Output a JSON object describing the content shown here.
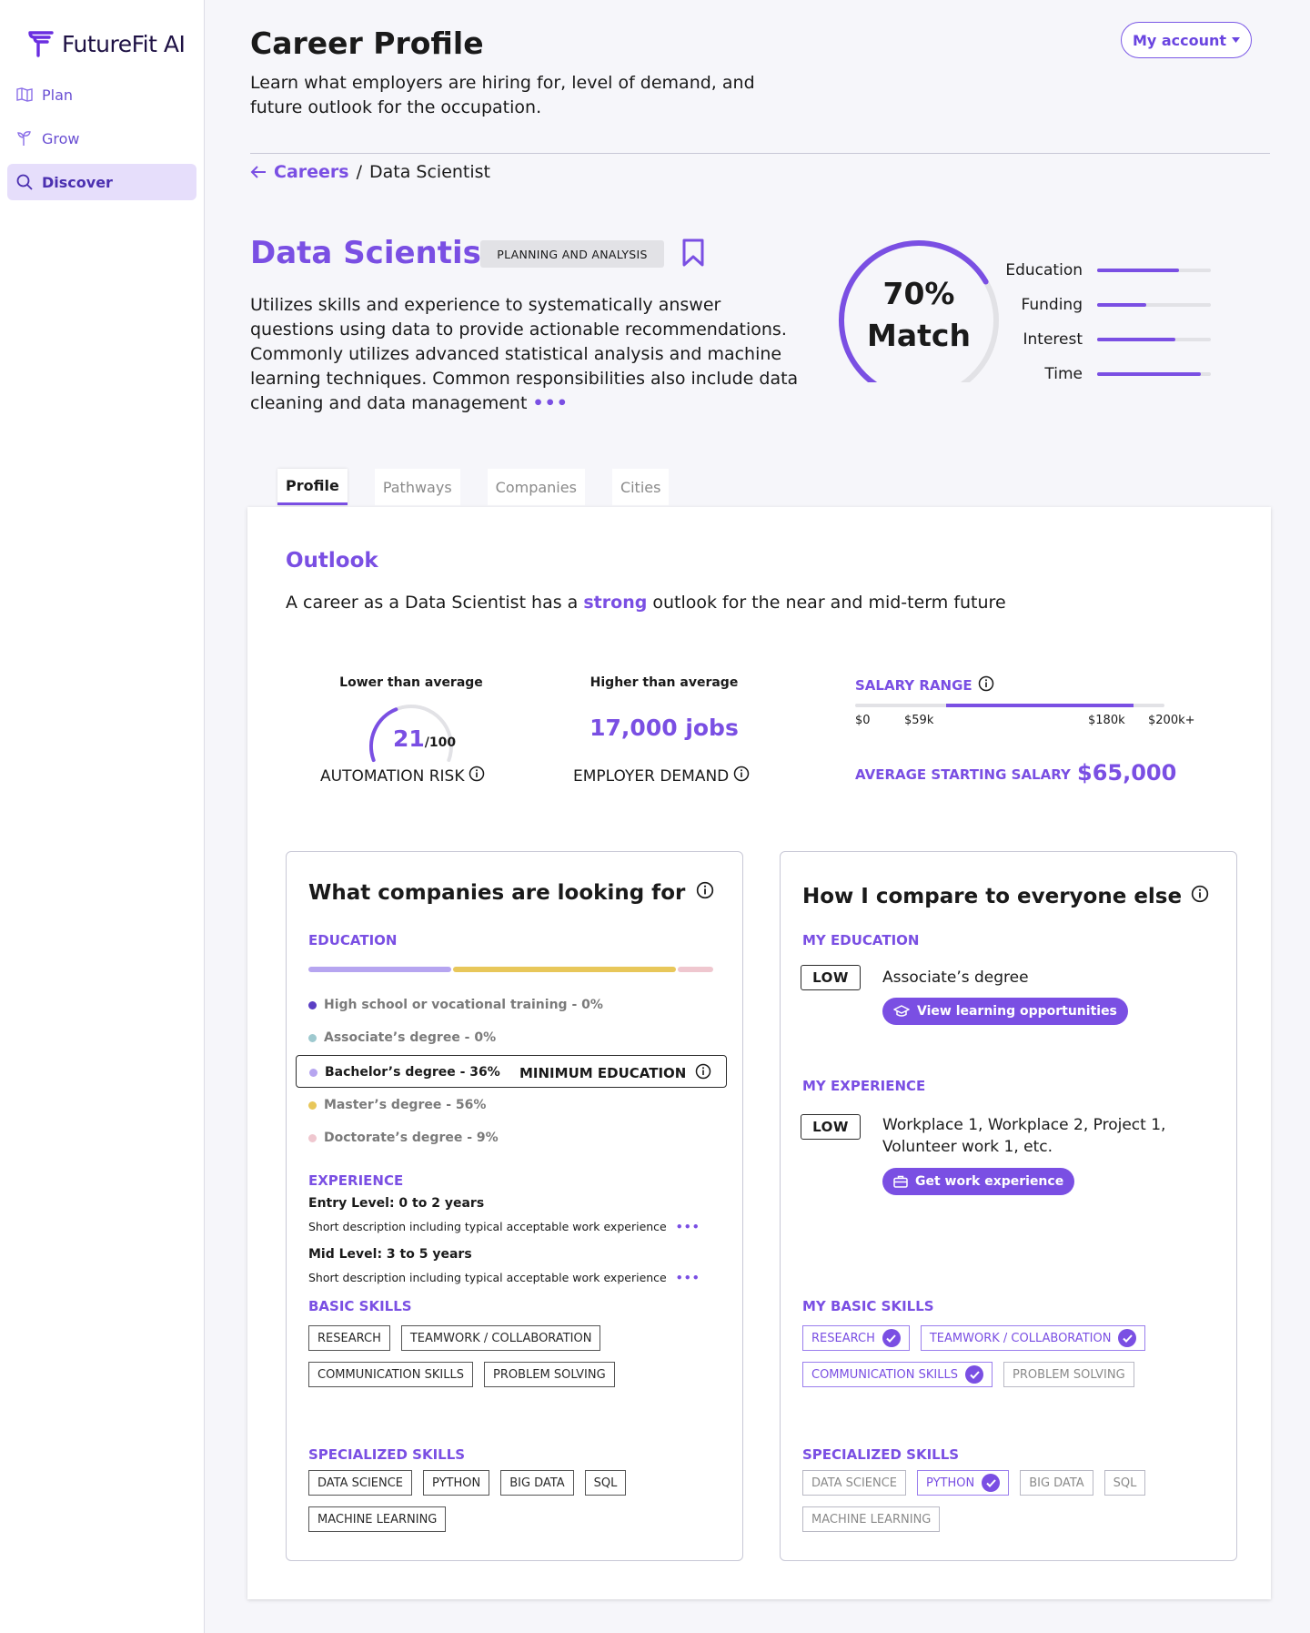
{
  "app": {
    "name": "FutureFit AI"
  },
  "nav": [
    {
      "label": "Plan",
      "icon": "map-icon"
    },
    {
      "label": "Grow",
      "icon": "sprout-icon"
    },
    {
      "label": "Discover",
      "icon": "search-icon",
      "active": true
    }
  ],
  "header": {
    "title": "Career Profile",
    "subtitle": "Learn what employers are hiring for, level of demand, and future outlook for the occupation.",
    "account_label": "My account"
  },
  "breadcrumb": {
    "parent": "Careers",
    "separator": "/",
    "current": "Data Scientist"
  },
  "career": {
    "title": "Data Scientist",
    "category": "PLANNING AND ANALYSIS",
    "description": "Utilizes skills and experience to systematically answer questions using data to provide actionable recommendations. Commonly utilizes advanced statistical analysis and machine learning techniques. Common responsibilities also include data cleaning and data management",
    "more": "•••"
  },
  "match": {
    "percent_label": "70%",
    "word": "Match",
    "value": 0.7,
    "factors": [
      {
        "label": "Education",
        "value": 0.72
      },
      {
        "label": "Funding",
        "value": 0.43
      },
      {
        "label": "Interest",
        "value": 0.69
      },
      {
        "label": "Time",
        "value": 0.91
      }
    ]
  },
  "tabs": [
    "Profile",
    "Pathways",
    "Companies",
    "Cities"
  ],
  "outlook": {
    "title": "Outlook",
    "text_before": "A career as a Data Scientist has a",
    "text_strong": "strong",
    "text_after": "outlook for the near and mid-term future"
  },
  "stats": {
    "automation": {
      "caption": "Lower than average",
      "value": "21",
      "denominator": "/100",
      "score": 21,
      "label": "AUTOMATION RISK"
    },
    "demand": {
      "caption": "Higher than average",
      "value": "17,000 jobs",
      "label": "EMPLOYER DEMAND"
    },
    "salary": {
      "label": "SALARY RANGE",
      "ticks": [
        "$0",
        "$59k",
        "$180k",
        "$200k+"
      ],
      "range_min": 59,
      "range_max": 180,
      "scale_max": 200,
      "avg_label": "AVERAGE STARTING SALARY",
      "avg_value": "$65,000"
    }
  },
  "companies": {
    "title": "What companies are looking for",
    "education_head": "EDUCATION",
    "education": [
      {
        "label": "High school or vocational training - 0%",
        "color": "#5b3fc4",
        "pct": 0
      },
      {
        "label": "Associate’s degree - 0%",
        "color": "#9ec9cf",
        "pct": 0
      },
      {
        "label": "Bachelor’s degree - 36%",
        "color": "#b6a5f0",
        "pct": 36,
        "minimum": true
      },
      {
        "label": "Master’s degree - 56%",
        "color": "#e8c75a",
        "pct": 56
      },
      {
        "label": "Doctorate’s degree - 9%",
        "color": "#efc7cf",
        "pct": 9
      }
    ],
    "minimum_label": "MINIMUM EDUCATION",
    "experience_head": "EXPERIENCE",
    "experience": [
      {
        "level": "Entry Level: 0 to 2 years",
        "desc": "Short description including typical acceptable work experience"
      },
      {
        "level": "Mid Level: 3 to 5 years",
        "desc": "Short description including typical acceptable work experience"
      }
    ],
    "basic_head": "BASIC SKILLS",
    "basic_skills": [
      "RESEARCH",
      "TEAMWORK / COLLABORATION",
      "COMMUNICATION SKILLS",
      "PROBLEM SOLVING"
    ],
    "specialized_head": "SPECIALIZED SKILLS",
    "specialized_skills": [
      "DATA SCIENCE",
      "PYTHON",
      "BIG DATA",
      "SQL",
      "MACHINE LEARNING"
    ]
  },
  "compare": {
    "title": "How I compare to everyone else",
    "education_head": "MY EDUCATION",
    "education_level": "LOW",
    "education_value": "Associate’s degree",
    "education_action": "View learning opportunities",
    "experience_head": "MY EXPERIENCE",
    "experience_level": "LOW",
    "experience_value": "Workplace 1, Workplace 2, Project 1, Volunteer work 1, etc.",
    "experience_action": "Get work experience",
    "basic_head": "MY BASIC SKILLS",
    "basic_skills": [
      {
        "label": "RESEARCH",
        "has": true
      },
      {
        "label": "TEAMWORK / COLLABORATION",
        "has": true
      },
      {
        "label": "COMMUNICATION SKILLS",
        "has": true
      },
      {
        "label": "PROBLEM SOLVING",
        "has": false
      }
    ],
    "specialized_head": "SPECIALIZED SKILLS",
    "specialized_skills": [
      {
        "label": "DATA SCIENCE",
        "has": false
      },
      {
        "label": "PYTHON",
        "has": true
      },
      {
        "label": "BIG DATA",
        "has": false
      },
      {
        "label": "SQL",
        "has": false
      },
      {
        "label": "MACHINE LEARNING",
        "has": false
      }
    ]
  },
  "colors": {
    "accent": "#7a4fe3",
    "track": "#e2e2e6"
  }
}
